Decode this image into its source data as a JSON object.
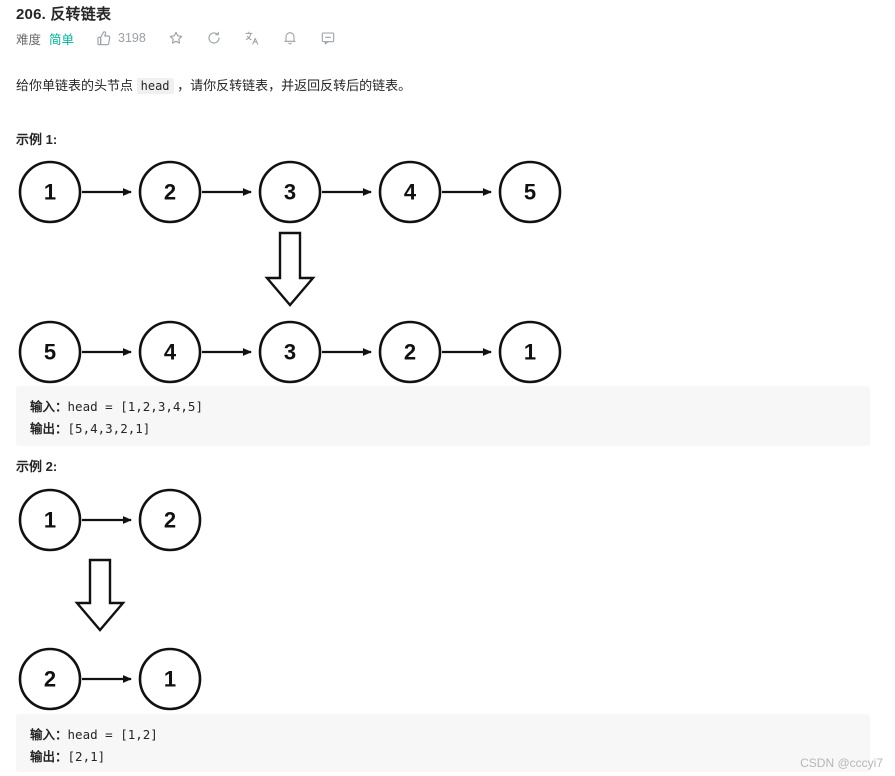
{
  "header": {
    "title": "206. 反转链表",
    "difficulty_label": "难度",
    "difficulty_value": "简单",
    "difficulty_color": "#00af9b",
    "likes": "3198",
    "icons": [
      "thumbs-up-icon",
      "star-icon",
      "refresh-icon",
      "translate-icon",
      "bell-icon",
      "comment-icon"
    ]
  },
  "description": {
    "before": "给你单链表的头节点 ",
    "code": "head",
    "after": " ，请你反转链表，并返回反转后的链表。"
  },
  "examples": [
    {
      "heading": "示例 1:",
      "list_before": [
        "1",
        "2",
        "3",
        "4",
        "5"
      ],
      "list_after": [
        "5",
        "4",
        "3",
        "2",
        "1"
      ],
      "input_label": "输入：",
      "input_value": "head = [1,2,3,4,5]",
      "output_label": "输出：",
      "output_value": "[5,4,3,2,1]"
    },
    {
      "heading": "示例 2:",
      "list_before": [
        "1",
        "2"
      ],
      "list_after": [
        "2",
        "1"
      ],
      "input_label": "输入：",
      "input_value": "head = [1,2]",
      "output_label": "输出：",
      "output_value": "[2,1]"
    }
  ],
  "watermark": "CSDN @cccyi7"
}
